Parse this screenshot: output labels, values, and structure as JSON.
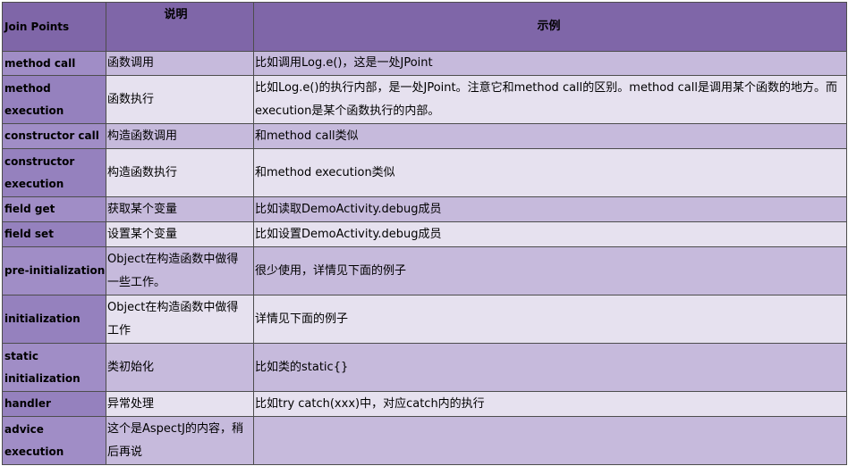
{
  "table": {
    "headers": [
      "Join Points",
      "说明",
      "示例"
    ],
    "rows": [
      {
        "join_point": "method call",
        "description": "函数调用",
        "example": "比如调用Log.e()，这是一处JPoint"
      },
      {
        "join_point": "method execution",
        "description": "函数执行",
        "example": "比如Log.e()的执行内部，是一处JPoint。注意它和method call的区别。method call是调用某个函数的地方。而execution是某个函数执行的内部。"
      },
      {
        "join_point": "constructor call",
        "description": "构造函数调用",
        "example": "和method call类似"
      },
      {
        "join_point": "constructor execution",
        "description": "构造函数执行",
        "example": "和method execution类似"
      },
      {
        "join_point": "field get",
        "description": "获取某个变量",
        "example": "比如读取DemoActivity.debug成员"
      },
      {
        "join_point": "field set",
        "description": "设置某个变量",
        "example": "比如设置DemoActivity.debug成员"
      },
      {
        "join_point": "pre-initialization",
        "description": "Object在构造函数中做得一些工作。",
        "example": "很少使用，详情见下面的例子"
      },
      {
        "join_point": "initialization",
        "description": "Object在构造函数中做得工作",
        "example": "详情见下面的例子"
      },
      {
        "join_point": "static initialization",
        "description": "类初始化",
        "example": "比如类的static{}"
      },
      {
        "join_point": "handler",
        "description": "异常处理",
        "example": "比如try catch(xxx)中，对应catch内的执行"
      },
      {
        "join_point": "advice execution",
        "description": "这个是AspectJ的内容，稍后再说",
        "example": ""
      }
    ]
  },
  "colors": {
    "header_bg": "#7f66a8",
    "first_col_odd": "#a08dc6",
    "first_col_even": "#9581be",
    "row_odd": "#c6badc",
    "row_even": "#e6e1ef",
    "border": "#4d4d4d",
    "text": "#000000"
  }
}
